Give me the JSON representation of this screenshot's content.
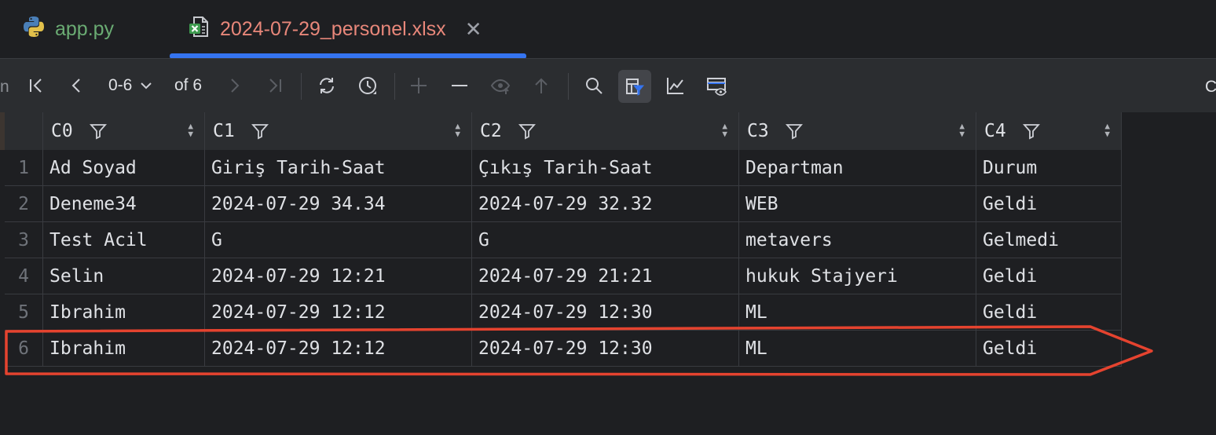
{
  "tabs": [
    {
      "label": "app.py",
      "icon": "python-file-icon",
      "active": false
    },
    {
      "label": "2024-07-29_personel.xlsx",
      "icon": "excel-file-icon",
      "active": true
    }
  ],
  "toolbar": {
    "range": "0-6",
    "of": "of 6",
    "edge_right": "C",
    "edge_left": "n"
  },
  "columns": [
    "C0",
    "C1",
    "C2",
    "C3",
    "C4"
  ],
  "rows": [
    {
      "num": "1",
      "cells": [
        "Ad Soyad",
        "Giriş Tarih-Saat",
        "Çıkış Tarih-Saat",
        "Departman",
        "Durum"
      ]
    },
    {
      "num": "2",
      "cells": [
        "Deneme34",
        "2024-07-29 34.34",
        "2024-07-29 32.32",
        "WEB",
        "Geldi"
      ]
    },
    {
      "num": "3",
      "cells": [
        "Test Acil",
        "G",
        "G",
        "metavers",
        "Gelmedi"
      ]
    },
    {
      "num": "4",
      "cells": [
        "Selin",
        "2024-07-29 12:21",
        "2024-07-29 21:21",
        "hukuk Stajyeri",
        "Geldi"
      ]
    },
    {
      "num": "5",
      "cells": [
        "Ibrahim",
        "2024-07-29 12:12",
        "2024-07-29 12:30",
        "ML",
        "Geldi"
      ]
    },
    {
      "num": "6",
      "cells": [
        "Ibrahim",
        "2024-07-29 12:12",
        "2024-07-29 12:30",
        "ML",
        "Geldi"
      ]
    }
  ],
  "colors": {
    "accent": "#3574f0",
    "annotation": "#e5432f",
    "python_tab": "#6aab73",
    "xlsx_tab": "#e8877a"
  }
}
